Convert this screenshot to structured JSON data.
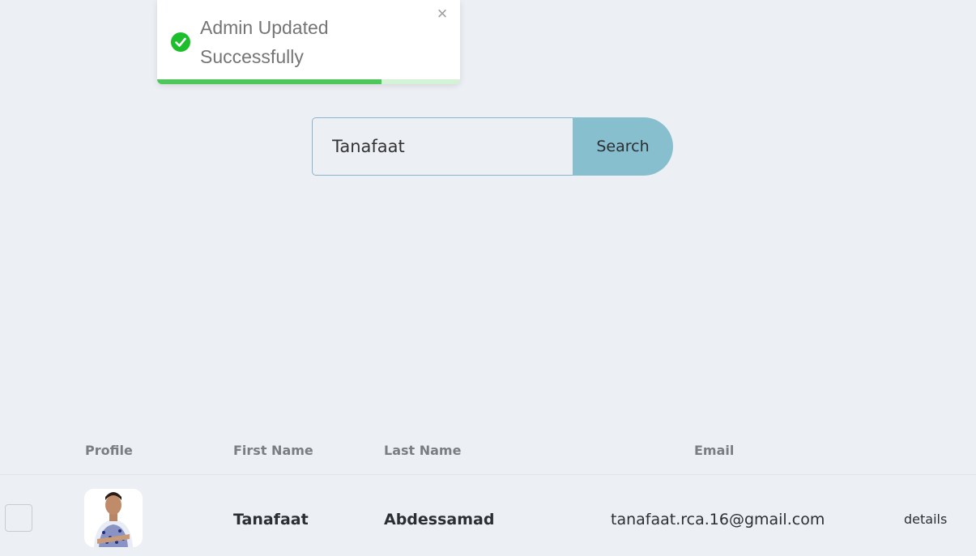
{
  "toast": {
    "message": "Admin Updated Successfully",
    "icon": "check-circle-icon",
    "close_symbol": "×",
    "progress": 0.74,
    "accent_color": "#1cbf2b"
  },
  "search": {
    "value": "Tanafaat",
    "button_label": "Search"
  },
  "table": {
    "columns": [
      "Profile",
      "First Name",
      "Last Name",
      "Email"
    ],
    "rows": [
      {
        "first_name": "Tanafaat",
        "last_name": "Abdessamad",
        "email": "tanafaat.rca.16@gmail.com",
        "action_label": "details"
      }
    ]
  }
}
